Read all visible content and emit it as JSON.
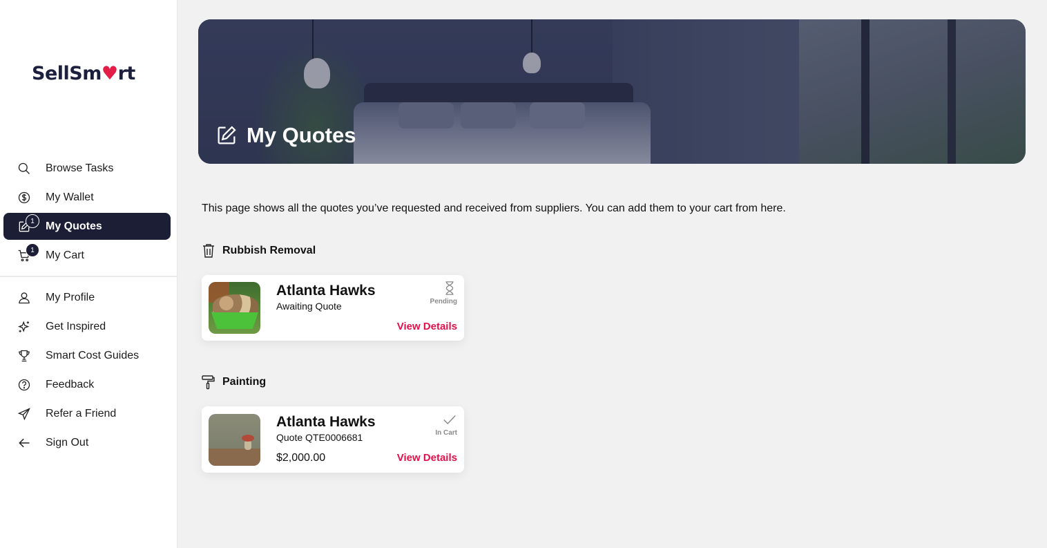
{
  "brand": {
    "name_part1": "SellSm",
    "name_heart": "♥",
    "name_part2": "rt",
    "accent": "#e0104a",
    "primary": "#1b1e35"
  },
  "sidebar": {
    "items": [
      {
        "label": "Browse Tasks",
        "icon": "search-icon"
      },
      {
        "label": "My Wallet",
        "icon": "dollar-icon"
      },
      {
        "label": "My Quotes",
        "icon": "edit-icon",
        "badge": "1",
        "active": true
      },
      {
        "label": "My Cart",
        "icon": "cart-icon",
        "badge": "1"
      },
      {
        "label": "My Profile",
        "icon": "user-icon"
      },
      {
        "label": "Get Inspired",
        "icon": "sparkle-icon"
      },
      {
        "label": "Smart Cost Guides",
        "icon": "trophy-icon"
      },
      {
        "label": "Feedback",
        "icon": "question-icon"
      },
      {
        "label": "Refer a Friend",
        "icon": "send-icon"
      },
      {
        "label": "Sign Out",
        "icon": "arrow-left-icon"
      }
    ]
  },
  "hero": {
    "title": "My Quotes",
    "icon": "edit-icon"
  },
  "intro": "This page shows all the quotes you’ve requested and received from suppliers. You can add them to your cart from here.",
  "sections": [
    {
      "title": "Rubbish Removal",
      "icon": "trash-icon",
      "card": {
        "name": "Atlanta Hawks",
        "sub": "Awaiting Quote",
        "price": "",
        "status": "Pending",
        "status_icon": "hourglass-icon",
        "action": "View Details"
      }
    },
    {
      "title": "Painting",
      "icon": "paint-roller-icon",
      "card": {
        "name": "Atlanta Hawks",
        "sub": "Quote QTE0006681",
        "price": "$2,000.00",
        "status": "In Cart",
        "status_icon": "check-icon",
        "action": "View Details"
      }
    }
  ]
}
